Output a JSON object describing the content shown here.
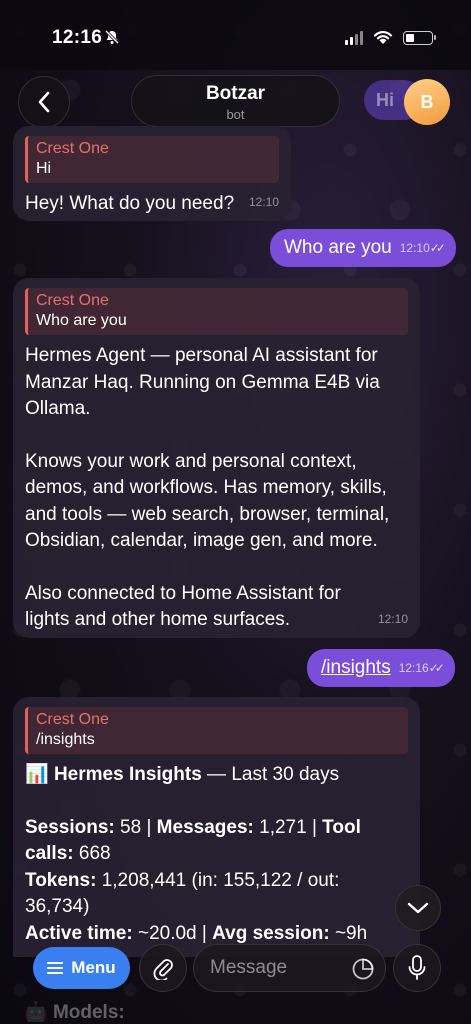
{
  "status_bar": {
    "time": "12:16"
  },
  "header": {
    "title": "Botzar",
    "subtitle": "bot",
    "behind_label": "Hi",
    "avatar_letter": "B"
  },
  "messages": {
    "m1": {
      "quote_name": "Crest One",
      "quote_text": "Hi",
      "text": "Hey! What do you need?",
      "time": "12:10"
    },
    "m2": {
      "text": "Who are you",
      "time": "12:10"
    },
    "m3": {
      "quote_name": "Crest One",
      "quote_text": "Who are you",
      "para1": "Hermes Agent — personal AI assistant for Manzar Haq. Running on Gemma E4B via Ollama.",
      "para2": "Knows your work and personal context, demos, and workflows. Has memory, skills, and tools — web search, browser, terminal, Obsidian, calendar, image gen, and more.",
      "para3": "Also connected to Home Assistant for lights and other home surfaces.",
      "time": "12:10"
    },
    "m4": {
      "text": "/insights",
      "time": "12:16"
    },
    "m5": {
      "quote_name": "Crest One",
      "quote_text": "/insights",
      "emoji": "📊",
      "title": "Hermes Insights",
      "title_rest": " — Last 30 days",
      "sessions_label": "Sessions:",
      "sessions_value": " 58 | ",
      "messages_label": "Messages:",
      "messages_value": " 1,271 | ",
      "tool_label": "Tool calls:",
      "tool_value": " 668",
      "tokens_label": "Tokens:",
      "tokens_value": " 1,208,441 (in: 155,122 / out: 36,734)",
      "active_label": "Active time:",
      "active_value": " ~20.0d | ",
      "avg_label": "Avg session:",
      "avg_value": " ~9h",
      "peek_label": "Models:"
    }
  },
  "composer": {
    "menu_label": "Menu",
    "placeholder": "Message"
  },
  "colors": {
    "accent_blue": "#3a7ff0",
    "outgoing_bubble": "#7b4ed9",
    "quote_red": "#e5605e"
  }
}
